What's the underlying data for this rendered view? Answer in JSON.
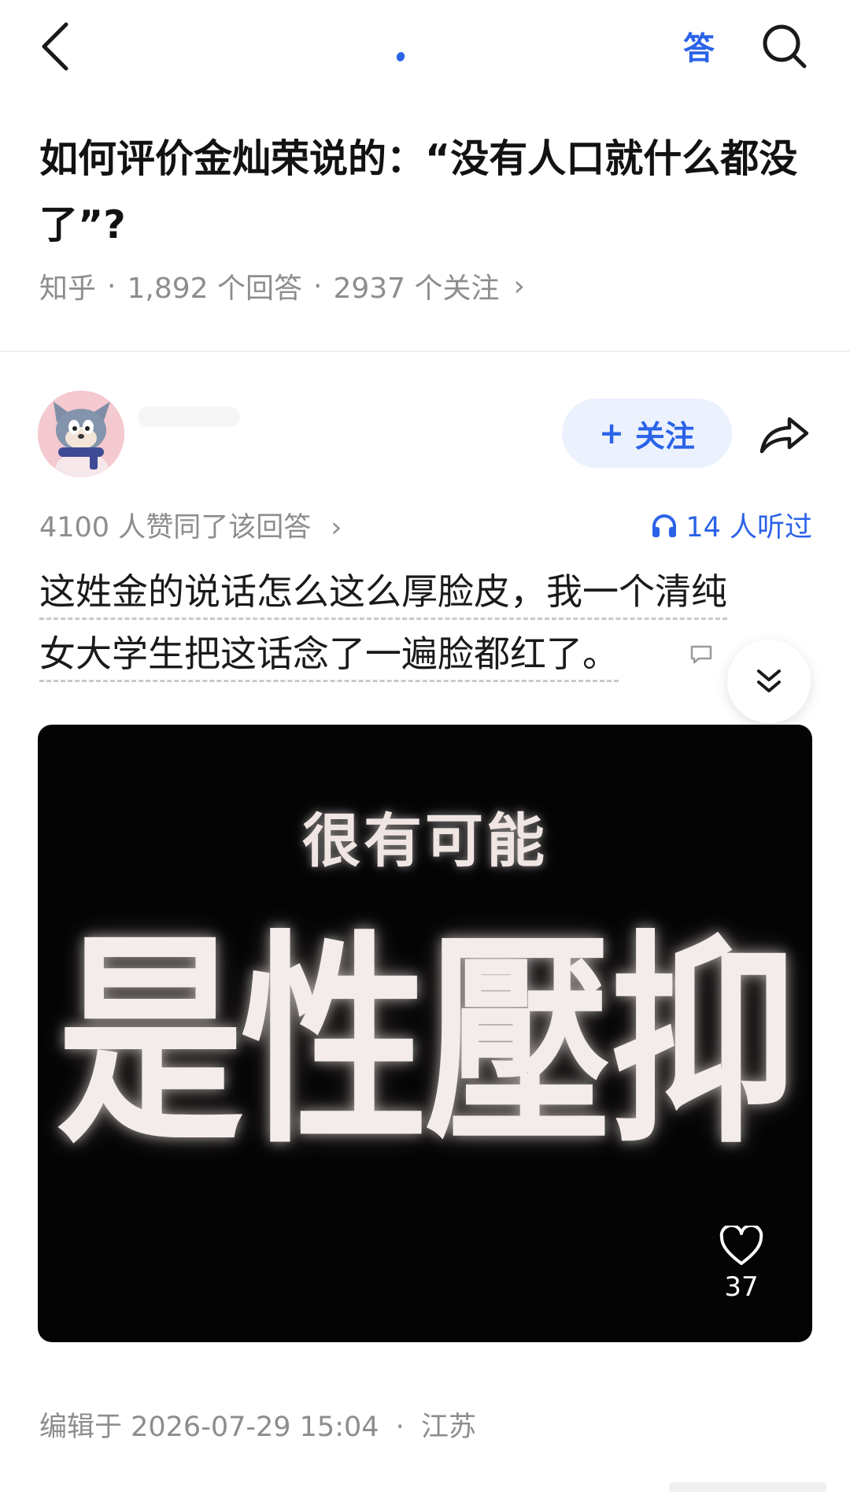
{
  "topbar": {
    "answer_label": "答"
  },
  "question": {
    "title": "如何评价金灿荣说的：“没有人口就什么都没了”?",
    "source": "知乎",
    "meta_sep": "·",
    "answer_count": "1,892 个回答",
    "follow_count": "2937 个关注",
    "more_chevron": "›"
  },
  "author": {
    "follow_plus": "+",
    "follow_label": "关注"
  },
  "stats": {
    "agree_text": "4100 人赞同了该回答",
    "agree_chevron": "›",
    "listened_text": "14 人听过"
  },
  "answer": {
    "line1": "这姓金的说话怎么这么厚脸皮，我一个清纯",
    "line2": "女大学生把这话念了一遍脸都红了。"
  },
  "image": {
    "caption_small": "很有可能",
    "caption_big": "是性壓抑",
    "like_count": "37"
  },
  "footer": {
    "edited_text": "编辑于 2026-07-29 15:04",
    "sep": "·",
    "location": "江苏"
  },
  "colors": {
    "accent": "#2b63e8",
    "meta_gray": "#8d8d8d",
    "follow_bg": "#ebf1fd",
    "image_bg": "#040404"
  },
  "icons": [
    "back-arrow-icon",
    "search-icon",
    "share-icon",
    "headphones-icon",
    "comment-icon",
    "double-chevron-down-icon",
    "heart-icon"
  ]
}
